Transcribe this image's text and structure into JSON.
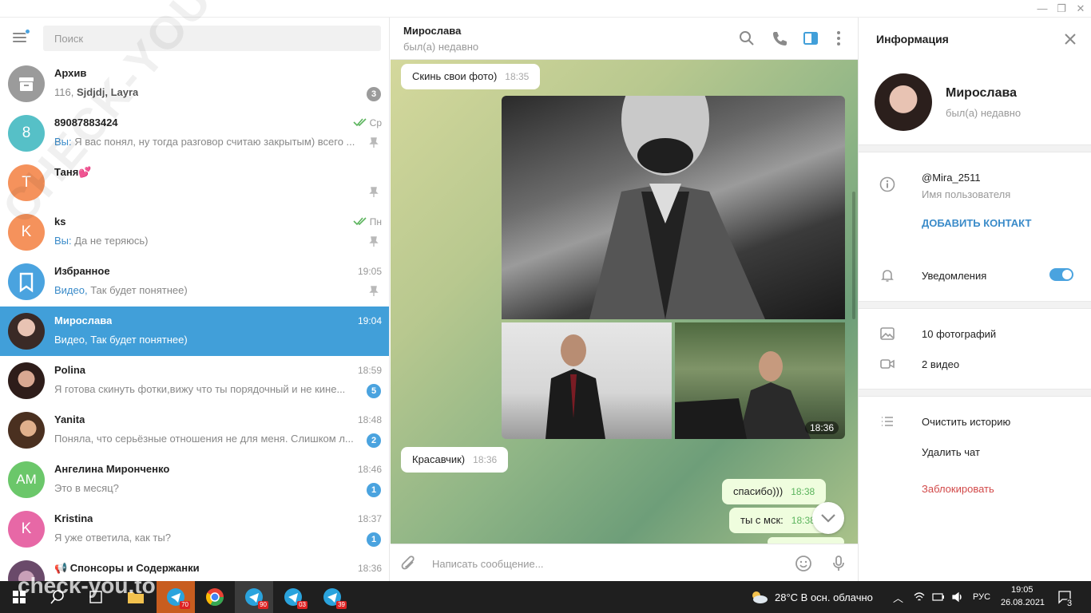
{
  "window": {
    "min": "—",
    "max": "❐",
    "close": "✕"
  },
  "search": {
    "placeholder": "Поиск"
  },
  "chats": [
    {
      "name": "Архив",
      "time": "",
      "preview_prefix": "116, ",
      "preview_bold": "Sjdjdj, Layra",
      "preview": "",
      "badge": "3",
      "avatar_color": "#9b9b9b",
      "avatar_text": ""
    },
    {
      "name": "89087883424",
      "time": "Ср",
      "preview_prefix": "Вы: ",
      "preview": "Я вас понял, ну тогда разговор считаю закрытым) всего ...",
      "avatar_color": "#56c0c7",
      "avatar_text": "8"
    },
    {
      "name": "Таня💕",
      "time": "",
      "preview_prefix": "",
      "preview": "",
      "avatar_color": "#f5925c",
      "avatar_text": "Т"
    },
    {
      "name": "ks",
      "time": "Пн",
      "preview_prefix": "Вы: ",
      "preview": "Да не теряюсь)",
      "avatar_color": "#f5925c",
      "avatar_text": "K"
    },
    {
      "name": "Избранное",
      "time": "19:05",
      "preview_prefix": "Видео, ",
      "preview": "Так будет понятнее)",
      "avatar_color": "#4aa3df",
      "avatar_text": ""
    },
    {
      "name": "Мирослава",
      "time": "19:04",
      "preview_prefix": "Видео, ",
      "preview": "Так будет понятнее)",
      "avatar_color": "#a5877a",
      "avatar_text": ""
    },
    {
      "name": "Polina",
      "time": "18:59",
      "preview_prefix": "",
      "preview": "Я готова скинуть фотки,вижу что ты порядочный и не кине...",
      "badge": "5",
      "avatar_color": "#6b4d47",
      "avatar_text": ""
    },
    {
      "name": "Yanita",
      "time": "18:48",
      "preview_prefix": "",
      "preview": "Поняла, что серьёзные отношения не для меня. Слишком л...",
      "badge": "2",
      "avatar_color": "#7a5a45",
      "avatar_text": ""
    },
    {
      "name": "Ангелина Миронченко",
      "time": "18:46",
      "preview_prefix": "",
      "preview": "Это в месяц?",
      "badge": "1",
      "avatar_color": "#6bc76a",
      "avatar_text": "AM"
    },
    {
      "name": "Kristina",
      "time": "18:37",
      "preview_prefix": "",
      "preview": "Я уже ответила, как ты?",
      "badge": "1",
      "avatar_color": "#e768a6",
      "avatar_text": "K"
    },
    {
      "name": "📢 Спонсоры и Содержанки",
      "time": "18:36",
      "preview_prefix": "",
      "preview": "",
      "avatar_color": "#8a6a8a",
      "avatar_text": ""
    }
  ],
  "chat_header": {
    "name": "Мирослава",
    "status": "был(а) недавно"
  },
  "messages": {
    "m1": {
      "text": "Скинь свои фото)",
      "time": "18:35"
    },
    "photos_time": "18:36",
    "m2": {
      "text": "Красавчик)",
      "time": "18:36"
    },
    "m3": {
      "text": "спасибо)))",
      "time": "18:38"
    },
    "m4": {
      "text": "ты с мск:",
      "time": "18:38"
    }
  },
  "composer": {
    "placeholder": "Написать сообщение..."
  },
  "info": {
    "title": "Информация",
    "name": "Мирослава",
    "status": "был(а) недавно",
    "username": "@Mira_2511",
    "username_label": "Имя пользователя",
    "add_contact": "ДОБАВИТЬ КОНТАКТ",
    "notifications": "Уведомления",
    "notifications_on": true,
    "photos": "10 фотографий",
    "videos": "2 видео",
    "clear_history": "Очистить историю",
    "delete_chat": "Удалить чат",
    "block": "Заблокировать"
  },
  "taskbar": {
    "badges": [
      "70",
      "90",
      "03",
      "39"
    ],
    "weather": "28°C  В осн. облачно",
    "lang": "РУС",
    "time": "19:05",
    "date": "26.08.2021",
    "notifications": "3"
  },
  "watermarks": {
    "diag": "CHECK-YOU.ME",
    "bottom": "check-you.to"
  },
  "colors": {
    "accent": "#419fd9",
    "badge": "#4aa3df",
    "danger": "#d24949"
  }
}
